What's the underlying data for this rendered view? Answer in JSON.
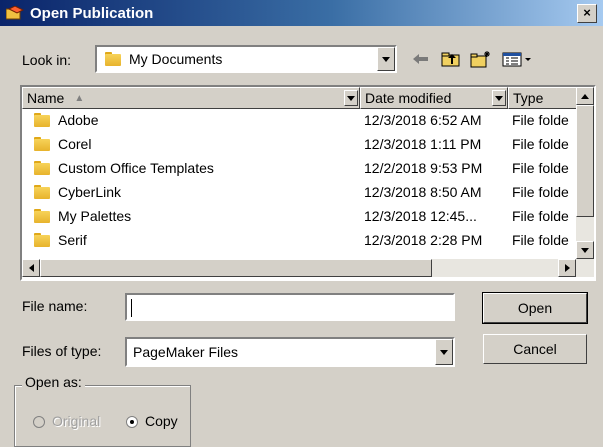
{
  "window": {
    "title": "Open Publication",
    "close_label": "×"
  },
  "lookin": {
    "label": "Look in:",
    "value": "My Documents"
  },
  "toolbar": {
    "back_icon": "back-arrow-icon",
    "up_icon": "up-folder-icon",
    "new_folder_icon": "new-folder-icon",
    "views_icon": "views-menu-icon"
  },
  "list": {
    "columns": {
      "name": "Name",
      "date": "Date modified",
      "type": "Type"
    },
    "rows": [
      {
        "name": "Adobe",
        "date": "12/3/2018 6:52 AM",
        "type": "File folde"
      },
      {
        "name": "Corel",
        "date": "12/3/2018 1:11 PM",
        "type": "File folde"
      },
      {
        "name": "Custom Office Templates",
        "date": "12/2/2018 9:53 PM",
        "type": "File folde"
      },
      {
        "name": "CyberLink",
        "date": "12/3/2018 8:50 AM",
        "type": "File folde"
      },
      {
        "name": "My Palettes",
        "date": "12/3/2018 12:45...",
        "type": "File folde"
      },
      {
        "name": "Serif",
        "date": "12/3/2018 2:28 PM",
        "type": "File folde"
      }
    ]
  },
  "filename": {
    "label": "File name:",
    "value": ""
  },
  "filetype": {
    "label": "Files of type:",
    "value": "PageMaker Files"
  },
  "buttons": {
    "open": "Open",
    "cancel": "Cancel"
  },
  "openas": {
    "label": "Open as:",
    "original": "Original",
    "copy": "Copy"
  },
  "colors": {
    "dialog_bg": "#d4d0c8",
    "titlebar_start": "#0a246a",
    "titlebar_end": "#a6caf0"
  }
}
